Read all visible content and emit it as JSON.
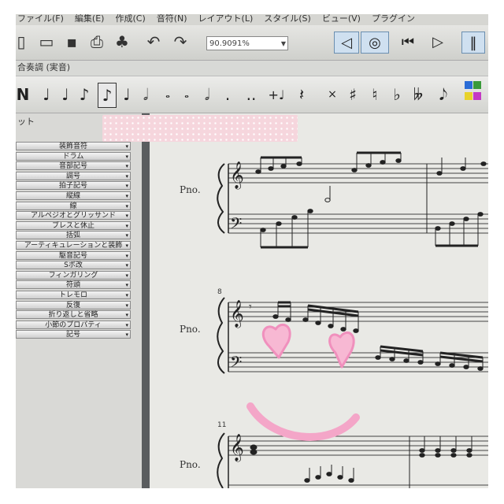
{
  "menubar": {
    "items": [
      "ファイル(F)",
      "編集(E)",
      "作成(C)",
      "音符(N)",
      "レイアウト(L)",
      "スタイル(S)",
      "ビュー(V)",
      "プラグイン"
    ]
  },
  "toolbar": {
    "zoom_value": "90.9091%"
  },
  "palette_title": "合奏調 (実音)",
  "notes": [
    "N",
    "♩",
    "♩",
    "♪",
    "♪",
    "♩",
    "𝅗𝅥",
    "𝅝",
    "𝅝",
    "𝅗𝅥",
    ".",
    "..",
    "+♩",
    "𝄽",
    "×",
    "♯",
    "♮",
    "♭",
    "𝄫",
    "𝅘𝅥𝅮"
  ],
  "panel": {
    "title": "ット",
    "items": [
      "装飾音符",
      "ドラム",
      "音部記号",
      "調号",
      "拍子記号",
      "縦線",
      "線",
      "アルペジオとグリッサンド",
      "ブレスと休止",
      "括弧",
      "アーティキュレーションと装飾",
      "駆音記号",
      "Sボ改",
      "フィンガリング",
      "符頭",
      "トレモロ",
      "反復",
      "折り返しと省略",
      "小節のプロパティ",
      "記号"
    ]
  },
  "score": {
    "instrument": "Pno.",
    "measure_numbers": [
      "8",
      "11"
    ]
  },
  "colors": {
    "doodle_pink": "#f4a6c8"
  }
}
